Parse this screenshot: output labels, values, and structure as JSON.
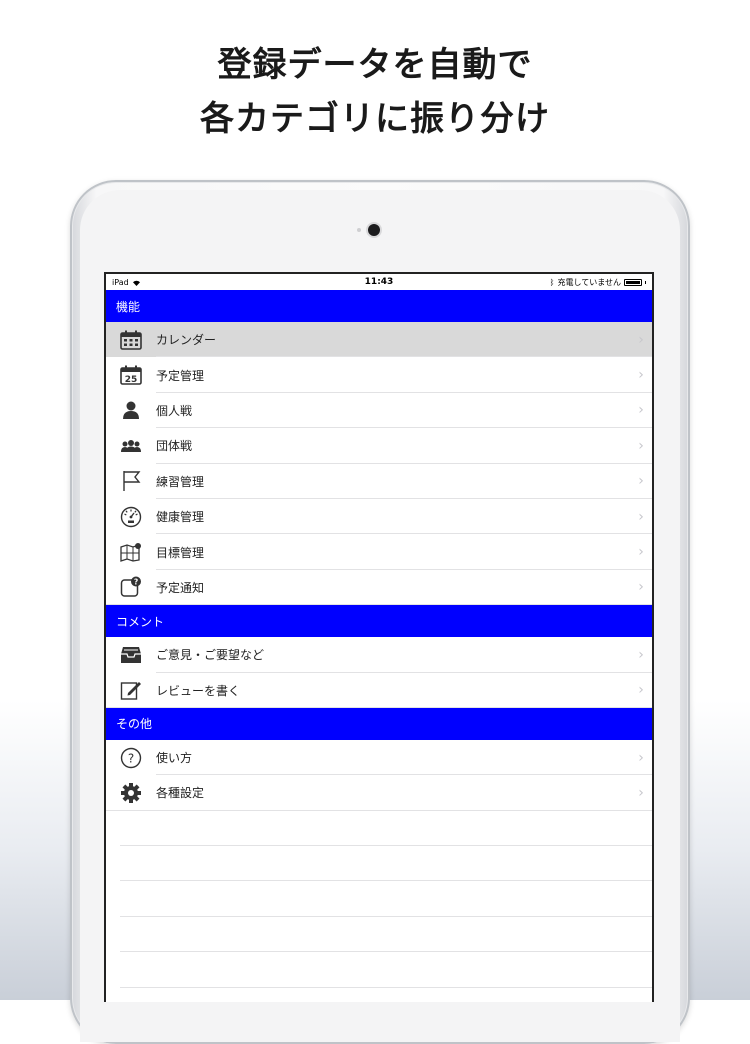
{
  "headline": {
    "line1": "登録データを自動で",
    "line2": "各カテゴリに振り分け"
  },
  "statusbar": {
    "device": "iPad",
    "time": "11:43",
    "charging": "充電していません"
  },
  "sections": [
    {
      "title": "機能",
      "items": [
        {
          "label": "カレンダー",
          "icon": "calendar-grid-icon",
          "selected": true
        },
        {
          "label": "予定管理",
          "icon": "calendar-25-icon"
        },
        {
          "label": "個人戦",
          "icon": "person-icon"
        },
        {
          "label": "団体戦",
          "icon": "group-icon"
        },
        {
          "label": "練習管理",
          "icon": "flag-icon"
        },
        {
          "label": "健康管理",
          "icon": "gauge-icon"
        },
        {
          "label": "目標管理",
          "icon": "map-pin-icon"
        },
        {
          "label": "予定通知",
          "icon": "notification-icon"
        }
      ]
    },
    {
      "title": "コメント",
      "items": [
        {
          "label": "ご意見・ご要望など",
          "icon": "inbox-icon"
        },
        {
          "label": "レビューを書く",
          "icon": "compose-icon"
        }
      ]
    },
    {
      "title": "その他",
      "items": [
        {
          "label": "使い方",
          "icon": "help-circle-icon"
        },
        {
          "label": "各種設定",
          "icon": "gear-icon"
        }
      ]
    }
  ],
  "chevron": "›",
  "colors": {
    "section_header": "#0000ff",
    "selected_row": "#d9d9d9",
    "chevron": "#c7c7cc"
  }
}
